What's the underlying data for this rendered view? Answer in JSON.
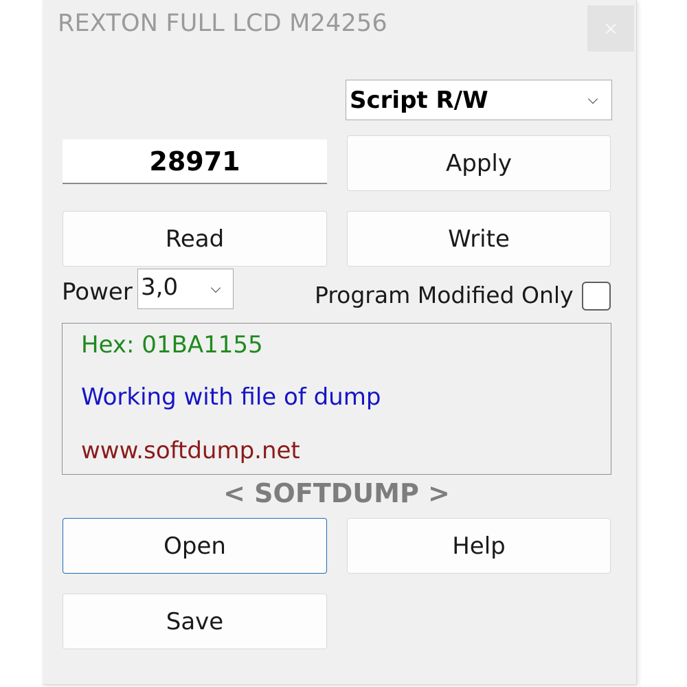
{
  "window": {
    "title": "REXTON FULL LCD M24256",
    "close_symbol": "×"
  },
  "mode_select": {
    "value": "Script R/W"
  },
  "code_field": {
    "value": "28971"
  },
  "buttons": {
    "apply": "Apply",
    "read": "Read",
    "write": "Write",
    "open": "Open",
    "help": "Help",
    "save": "Save"
  },
  "power": {
    "label": "Power",
    "value": "3,0"
  },
  "program_modified_only": {
    "label": "Program Modified Only",
    "checked": false
  },
  "log": {
    "hex_line": "Hex: 01BA1155",
    "status_line": "Working with file of dump",
    "url_line": "www.softdump.net",
    "colors": {
      "hex": "#1e8a1e",
      "status": "#1414c8",
      "url": "#8b1a1a"
    }
  },
  "brand_text": "< SOFTDUMP >",
  "icons": {
    "close": "close-icon",
    "dropdown": "chevron-down-icon"
  }
}
